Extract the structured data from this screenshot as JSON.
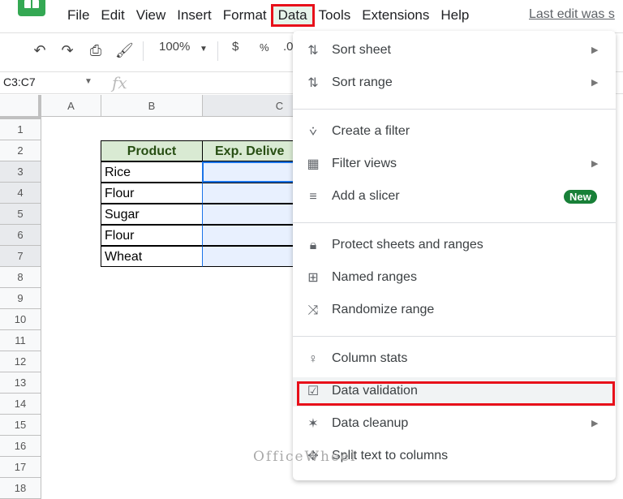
{
  "app": {
    "logo": "sheets-logo-icon",
    "menu": [
      "File",
      "Edit",
      "View",
      "Insert",
      "Format",
      "Data",
      "Tools",
      "Extensions",
      "Help"
    ],
    "active_menu": "Data",
    "last_edit": "Last edit was s"
  },
  "toolbar": {
    "undo": "undo-icon",
    "redo": "redo-icon",
    "print": "print-icon",
    "paint_format": "paint-format-icon",
    "zoom": "100%",
    "currency": "$",
    "percent": "%",
    "decimal": ".0"
  },
  "formula_bar": {
    "name_box": "C3:C7",
    "fx": "fx",
    "value": ""
  },
  "sheet": {
    "columns": [
      "A",
      "B",
      "C"
    ],
    "rows": [
      "1",
      "2",
      "3",
      "4",
      "5",
      "6",
      "7",
      "8",
      "9",
      "10",
      "11",
      "12",
      "13",
      "14",
      "15",
      "16",
      "17",
      "18"
    ],
    "table": {
      "headers": [
        "Product",
        "Exp. Delive"
      ],
      "products": [
        "Rice",
        "Flour",
        "Sugar",
        "Flour",
        "Wheat"
      ]
    }
  },
  "data_menu": {
    "items": [
      {
        "label": "Sort sheet",
        "icon": "sort-icon",
        "submenu": true
      },
      {
        "label": "Sort range",
        "icon": "sort-icon",
        "submenu": true
      },
      {
        "label": "Create a filter",
        "icon": "filter-icon",
        "submenu": false
      },
      {
        "label": "Filter views",
        "icon": "filter-views-icon",
        "submenu": true
      },
      {
        "label": "Add a slicer",
        "icon": "slicer-icon",
        "submenu": false,
        "badge": "New"
      },
      {
        "label": "Protect sheets and ranges",
        "icon": "lock-icon",
        "submenu": false
      },
      {
        "label": "Named ranges",
        "icon": "named-ranges-icon",
        "submenu": false
      },
      {
        "label": "Randomize range",
        "icon": "shuffle-icon",
        "submenu": false
      },
      {
        "label": "Column stats",
        "icon": "lightbulb-icon",
        "submenu": false
      },
      {
        "label": "Data validation",
        "icon": "data-validation-icon",
        "submenu": false,
        "highlighted": true
      },
      {
        "label": "Data cleanup",
        "icon": "magic-wand-icon",
        "submenu": true
      },
      {
        "label": "Split text to columns",
        "icon": "split-icon",
        "submenu": false
      }
    ]
  },
  "watermark": "OfficeWheel",
  "colors": {
    "highlight_red": "#e8101a",
    "header_fill": "#d9ead3",
    "selection_fill": "#e8f0fe",
    "badge_green": "#188038"
  }
}
